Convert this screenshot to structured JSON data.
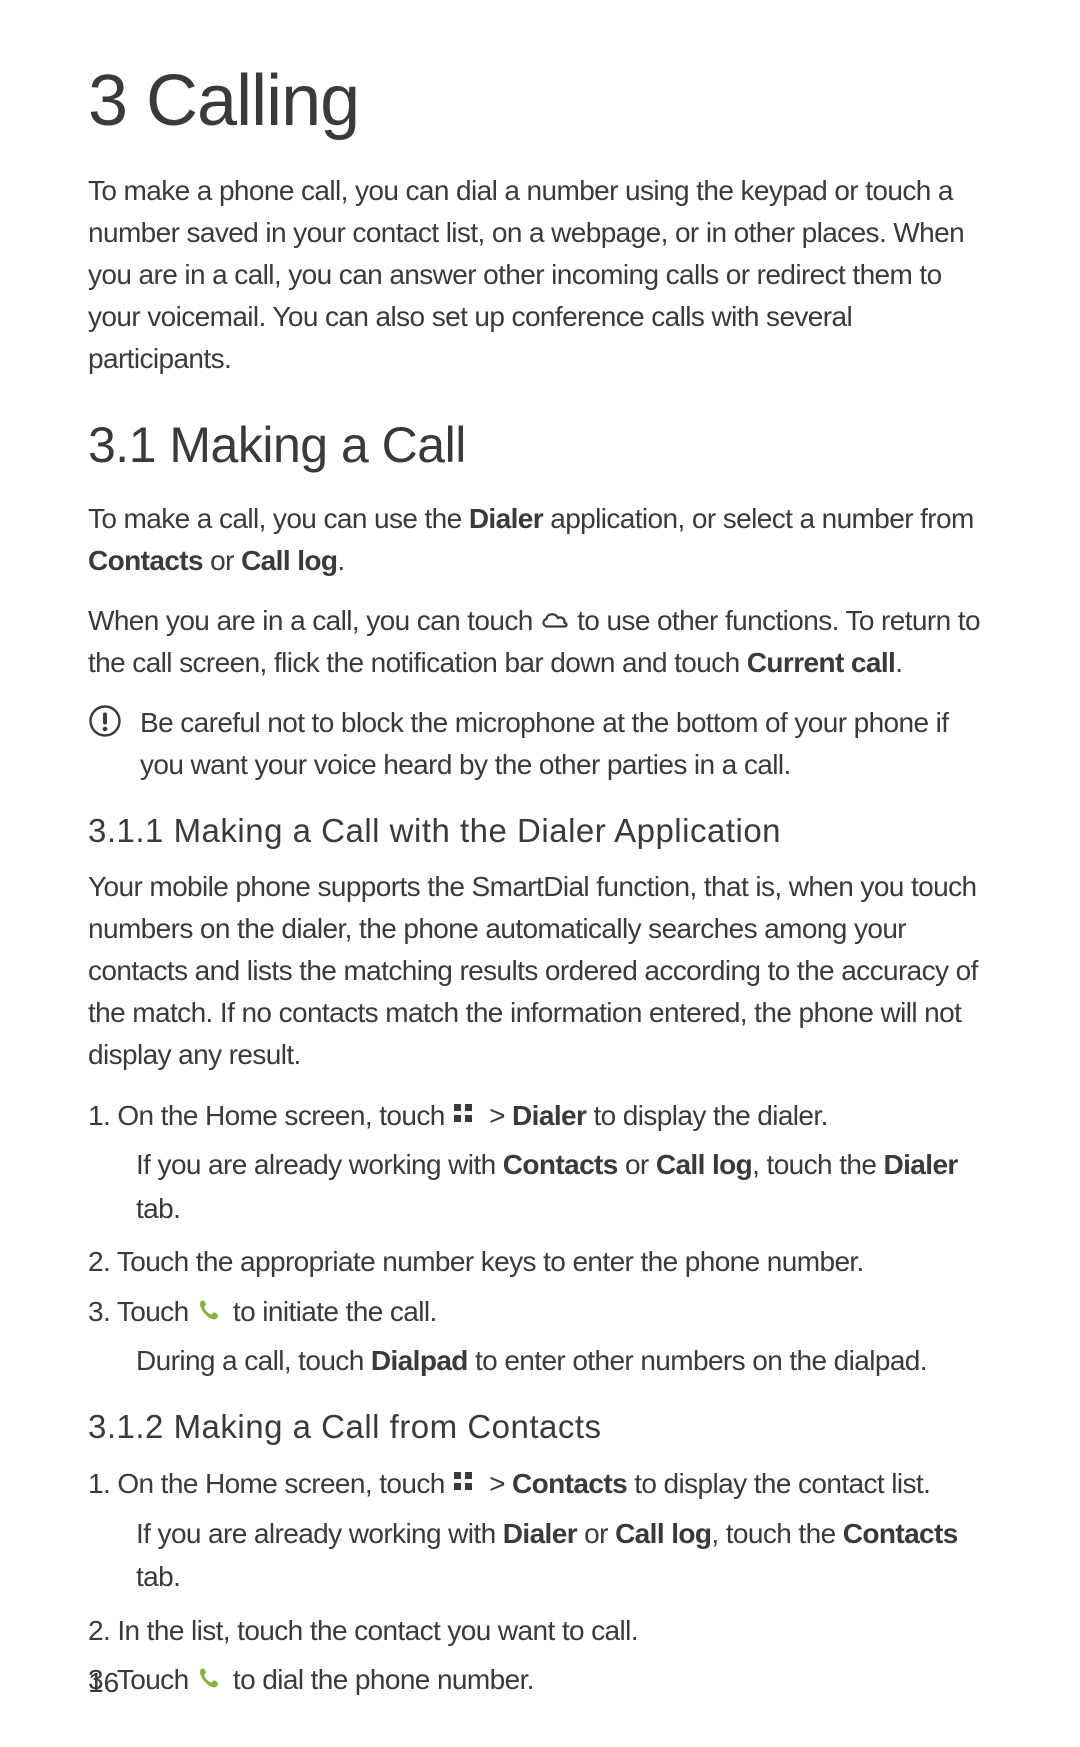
{
  "page": {
    "number": "16"
  },
  "headings": {
    "h1": "3  Calling",
    "h2": "3.1  Making a Call",
    "h3a": "3.1.1  Making a Call with the Dialer Application",
    "h3b": "3.1.2  Making a Call from Contacts"
  },
  "paras": {
    "intro": "To make a phone call, you can dial a number using the keypad or touch a number saved in your contact list, on a webpage, or in other places. When you are in a call, you can answer other incoming calls or redirect them to your voicemail. You can also set up conference calls with several participants.",
    "s31_a_pre": "To make a call, you can use the ",
    "s31_a_b1": "Dialer",
    "s31_a_mid1": " application, or select a number from ",
    "s31_a_b2": "Contacts",
    "s31_a_mid2": " or ",
    "s31_a_b3": "Call log",
    "s31_a_end": ".",
    "s31_b_pre": "When you are in a call, you can touch ",
    "s31_b_mid": " to use other functions. To return to the call screen, flick the notification bar down and touch ",
    "s31_b_b1": "Current call",
    "s31_b_end": ".",
    "note": "Be careful not to block the microphone at the bottom of your phone if you want your voice heard by the other parties in a call.",
    "s311": "Your mobile phone supports the SmartDial function, that is, when you touch numbers on the dialer, the phone automatically searches among your contacts and lists the matching results ordered according to the accuracy of the match. If no contacts match the information entered, the phone will not display any result."
  },
  "list311": {
    "l1_pre": "1. On the Home screen, touch ",
    "l1_mid": "  > ",
    "l1_b1": "Dialer",
    "l1_end": " to display the dialer.",
    "l1_sub_pre": "If you are already working with ",
    "l1_sub_b1": "Contacts",
    "l1_sub_mid1": " or ",
    "l1_sub_b2": "Call log",
    "l1_sub_mid2": ", touch the ",
    "l1_sub_b3": "Dialer",
    "l1_sub_end": " tab.",
    "l2": "2. Touch the appropriate number keys to enter the phone number.",
    "l3_pre": "3. Touch ",
    "l3_end": " to initiate the call.",
    "l3_sub_pre": "During a call, touch ",
    "l3_sub_b1": "Dialpad",
    "l3_sub_end": " to enter other numbers on the dialpad."
  },
  "list312": {
    "l1_pre": "1. On the Home screen, touch ",
    "l1_mid": "  > ",
    "l1_b1": "Contacts",
    "l1_end": " to display the contact list.",
    "l1_sub_pre": "If you are already working with ",
    "l1_sub_b1": "Dialer",
    "l1_sub_mid1": " or ",
    "l1_sub_b2": "Call log",
    "l1_sub_mid2": ", touch the ",
    "l1_sub_b3": "Contacts",
    "l1_sub_end": " tab.",
    "l2": "2. In the list, touch the contact you want to call.",
    "l3_pre": "3. Touch ",
    "l3_end": " to dial the phone number."
  },
  "icons": {
    "apps": "apps-grid-icon",
    "cloud": "cloud-icon",
    "phone": "phone-icon",
    "info": "info-icon"
  }
}
